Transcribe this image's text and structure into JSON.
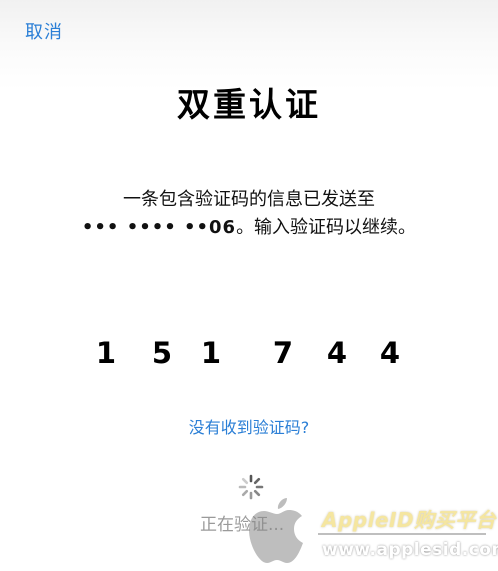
{
  "header": {
    "cancel_label": "取消"
  },
  "main": {
    "title": "双重认证",
    "message_line1": "一条包含验证码的信息已发送至",
    "masked_number": "••• •••• ••06",
    "message_line2_suffix": "。输入验证码以继续。",
    "code_digits": [
      "1",
      "5",
      "1",
      "7",
      "4",
      "4"
    ],
    "resend_link": "没有收到验证码?",
    "status_text": "正在验证..."
  },
  "watermark": {
    "brand": "AppleID购买平台",
    "url": "www.applesid.com"
  },
  "colors": {
    "link": "#2b7fd6",
    "status": "#9a9a9a",
    "brand_watermark": "#f5e6a0"
  }
}
